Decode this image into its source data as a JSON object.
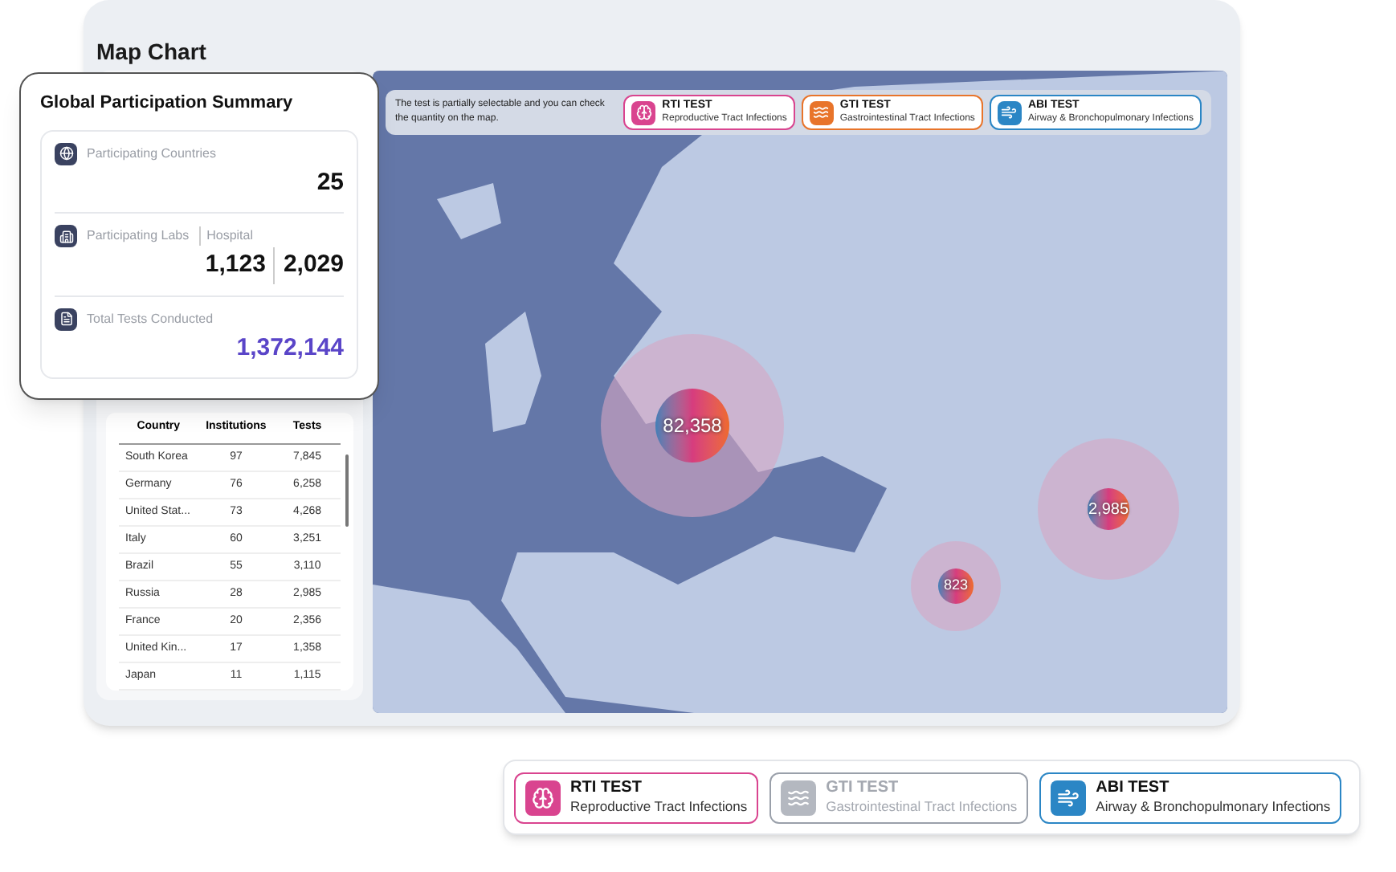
{
  "title": "Map Chart",
  "summary": {
    "title": "Global Participation Summary",
    "items": [
      {
        "kind": "countries",
        "labels": [
          "Participating Countries"
        ],
        "values": [
          "25"
        ],
        "accent": false
      },
      {
        "kind": "labs",
        "labels": [
          "Participating Labs",
          "Hospital"
        ],
        "values": [
          "1,123",
          "2,029"
        ],
        "accent": false
      },
      {
        "kind": "tests",
        "labels": [
          "Total Tests Conducted"
        ],
        "values": [
          "1,372,144"
        ],
        "accent": true
      }
    ]
  },
  "table": {
    "columns": [
      "Country",
      "Institutions",
      "Tests"
    ],
    "rows": [
      [
        "South Korea",
        "97",
        "7,845"
      ],
      [
        "Germany",
        "76",
        "6,258"
      ],
      [
        "United Stat...",
        "73",
        "4,268"
      ],
      [
        "Italy",
        "60",
        "3,251"
      ],
      [
        "Brazil",
        "55",
        "3,110"
      ],
      [
        "Russia",
        "28",
        "2,985"
      ],
      [
        "France",
        "20",
        "2,356"
      ],
      [
        "United Kin...",
        "17",
        "1,358"
      ],
      [
        "Japan",
        "11",
        "1,115"
      ]
    ]
  },
  "map": {
    "hint": "The test is partially selectable and you can check the quantity on the map.",
    "tests": [
      {
        "kind": "rti",
        "name": "RTI TEST",
        "description": "Reproductive Tract Infections",
        "selected": true,
        "color": "#d9448f"
      },
      {
        "kind": "gti",
        "name": "GTI TEST",
        "description": "Gastrointestinal Tract Infections",
        "selected": true,
        "color": "#e8742a"
      },
      {
        "kind": "abi",
        "name": "ABI TEST",
        "description": "Airway & Bronchopulmonary Infections",
        "selected": true,
        "color": "#2b86c5"
      }
    ],
    "markers": [
      {
        "value": "82,358"
      },
      {
        "value": "2,985"
      },
      {
        "value": "823"
      }
    ]
  },
  "legend": {
    "tests": [
      {
        "kind": "rti",
        "name": "RTI TEST",
        "description": "Reproductive Tract Infections",
        "selected": true,
        "color": "#d9448f"
      },
      {
        "kind": "gti",
        "name": "GTI TEST",
        "description": "Gastrointestinal Tract Infections",
        "selected": false
      },
      {
        "kind": "abi",
        "name": "ABI TEST",
        "description": "Airway & Bronchopulmonary Infections",
        "selected": true,
        "color": "#2b86c5"
      }
    ]
  }
}
